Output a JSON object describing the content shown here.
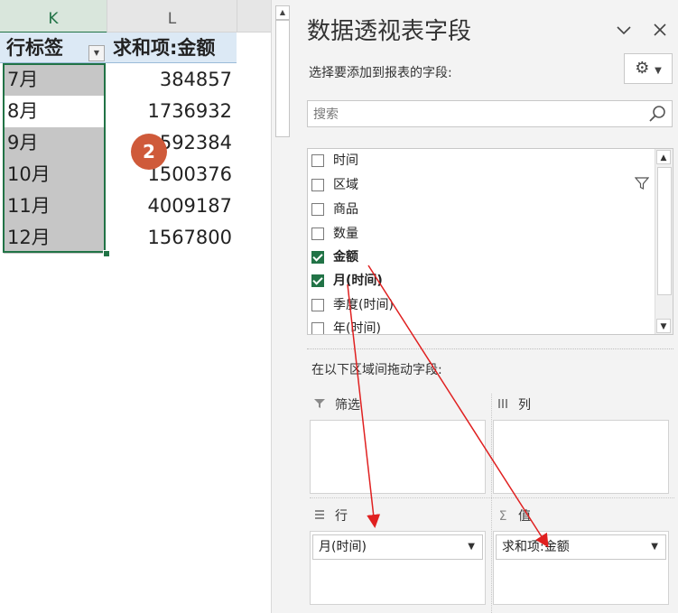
{
  "sheet": {
    "col_k": "K",
    "col_l": "L",
    "header_row": {
      "label": "行标签",
      "value": "求和项:金额"
    },
    "rows": [
      {
        "label": "7月",
        "value": "384857"
      },
      {
        "label": "8月",
        "value": "1736932"
      },
      {
        "label": "9月",
        "value": "592384"
      },
      {
        "label": "10月",
        "value": "1500376"
      },
      {
        "label": "11月",
        "value": "4009187"
      },
      {
        "label": "12月",
        "value": "1567800"
      }
    ],
    "badge": "2"
  },
  "pane": {
    "title": "数据透视表字段",
    "choose_label": "选择要添加到报表的字段:",
    "search_placeholder": "搜索",
    "fields": [
      {
        "label": "时间",
        "checked": false
      },
      {
        "label": "区域",
        "checked": false
      },
      {
        "label": "商品",
        "checked": false
      },
      {
        "label": "数量",
        "checked": false
      },
      {
        "label": "金额",
        "checked": true
      },
      {
        "label": "月(时间)",
        "checked": true
      },
      {
        "label": "季度(时间)",
        "checked": false
      },
      {
        "label": "年(时间)",
        "checked": false
      }
    ],
    "drag_label": "在以下区域间拖动字段:",
    "areas": {
      "filter": {
        "label": "筛选"
      },
      "columns": {
        "label": "列"
      },
      "rows": {
        "label": "行",
        "item": "月(时间)"
      },
      "values": {
        "label": "值",
        "item": "求和项:金额"
      }
    },
    "arrow_color": "#e02020",
    "accent": "#217346"
  }
}
